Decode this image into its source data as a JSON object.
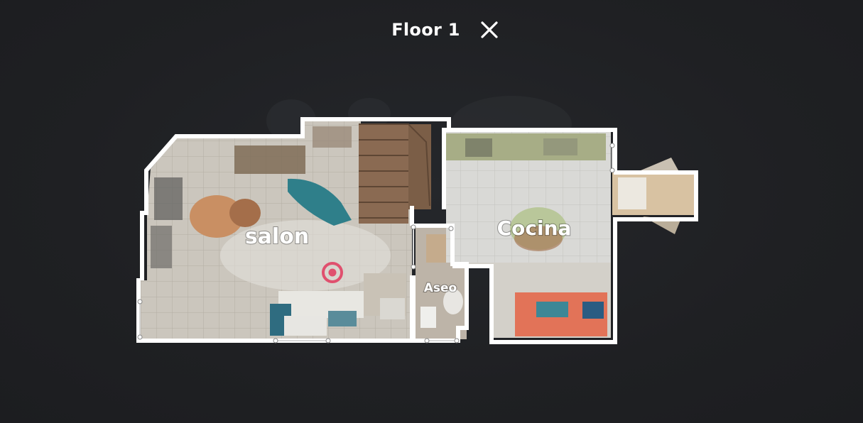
{
  "header": {
    "floor_title": "Floor 1",
    "close_icon": "close-icon"
  },
  "rooms": {
    "salon": "salon",
    "cocina": "Cocina",
    "aseo": "Aseo"
  },
  "marker": {
    "icon": "location-target-icon",
    "color": "#e0506e"
  },
  "colors": {
    "background": "#1f2023",
    "walls": "#ffffff",
    "floor_tile": "#cfcbc4"
  }
}
